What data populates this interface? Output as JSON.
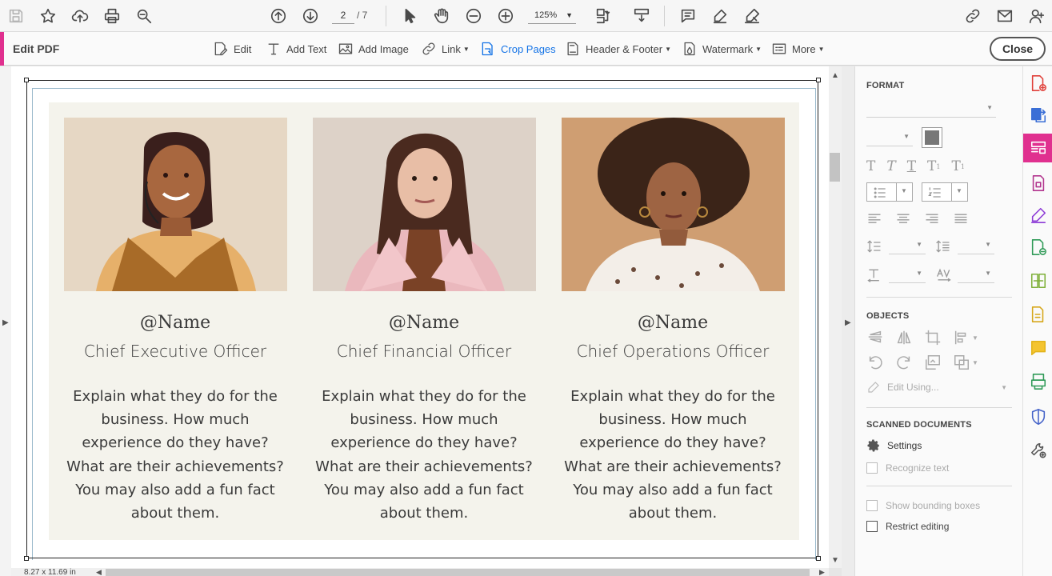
{
  "toolbar": {
    "page_current": "2",
    "page_total": "/ 7",
    "zoom": "125%"
  },
  "edit_toolbar": {
    "title": "Edit PDF",
    "edit": "Edit",
    "add_text": "Add Text",
    "add_image": "Add Image",
    "link": "Link",
    "crop_pages": "Crop Pages",
    "header_footer": "Header & Footer",
    "watermark": "Watermark",
    "more": "More",
    "close": "Close"
  },
  "document": {
    "cards": [
      {
        "name": "@Name",
        "role": "Chief Executive Officer",
        "desc": [
          "Explain what they do for the",
          "business. How much",
          "experience do they have?",
          "What are their achievements?",
          "You may also add a fun fact",
          "about them."
        ]
      },
      {
        "name": "@Name",
        "role": "Chief Financial Officer",
        "desc": [
          "Explain what they do for the",
          "business. How much",
          "experience do they have?",
          "What are their achievements?",
          "You may also add a fun fact",
          "about them."
        ]
      },
      {
        "name": "@Name",
        "role": "Chief Operations Officer",
        "desc": [
          "Explain what they do for the",
          "business. How much",
          "experience do they have?",
          "What are their achievements?",
          "You may also add a fun fact",
          "about them."
        ]
      }
    ]
  },
  "status": {
    "page_size": "8.27 x 11.69 in"
  },
  "format_panel": {
    "format_title": "FORMAT",
    "objects_title": "OBJECTS",
    "edit_using": "Edit Using...",
    "scanned_title": "SCANNED DOCUMENTS",
    "settings": "Settings",
    "recognize_text": "Recognize text",
    "show_bounding": "Show bounding boxes",
    "restrict_editing": "Restrict editing"
  },
  "colors": {
    "accent": "#e0308f",
    "active_blue": "#1473e6",
    "panel_bg": "#f4f3ec"
  }
}
